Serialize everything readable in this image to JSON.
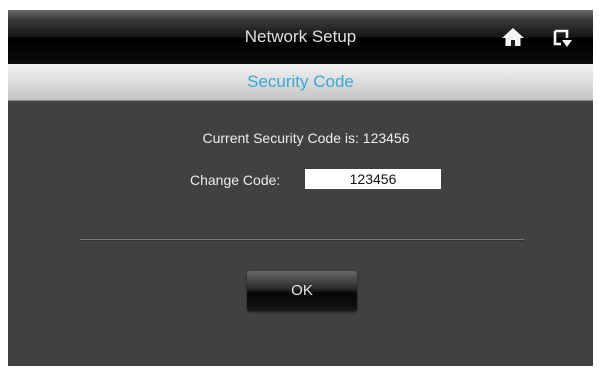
{
  "header": {
    "title": "Network Setup",
    "home_icon": "home-icon",
    "back_icon": "back-icon"
  },
  "subheader": {
    "title": "Security Code",
    "title_color": "#3aa9d6"
  },
  "form": {
    "current_code_text": "Current Security Code is: 123456",
    "change_label": "Change Code:",
    "change_value": "123456"
  },
  "actions": {
    "ok_label": "OK"
  }
}
